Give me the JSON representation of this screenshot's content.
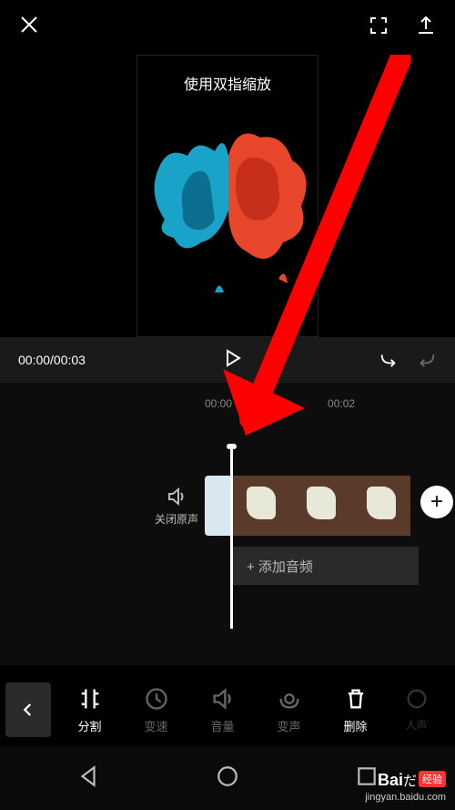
{
  "topbar": {
    "close_label": "close",
    "expand_label": "expand",
    "export_label": "export"
  },
  "preview": {
    "hint": "使用双指缩放"
  },
  "player": {
    "time": "00:00/00:03",
    "play_label": "play",
    "undo_label": "undo",
    "redo_label": "redo"
  },
  "timeline": {
    "marks": [
      "00:00",
      "00:02"
    ],
    "mute_label": "关闭原声",
    "add_clip_label": "+",
    "add_audio_label": "+  添加音频"
  },
  "toolbar": {
    "back_label": "back",
    "items": [
      {
        "id": "split",
        "label": "分割",
        "dim": false
      },
      {
        "id": "speed",
        "label": "变速",
        "dim": true
      },
      {
        "id": "volume",
        "label": "音量",
        "dim": true
      },
      {
        "id": "voice",
        "label": "变声",
        "dim": true
      },
      {
        "id": "delete",
        "label": "删除",
        "dim": false
      },
      {
        "id": "voicefx",
        "label": "人声",
        "dim": true
      }
    ]
  },
  "watermark": {
    "brand": "Bai",
    "brand2": "经验",
    "url": "jingyan.baidu.com"
  },
  "annotation": {
    "arrow_color": "#ff0000"
  }
}
